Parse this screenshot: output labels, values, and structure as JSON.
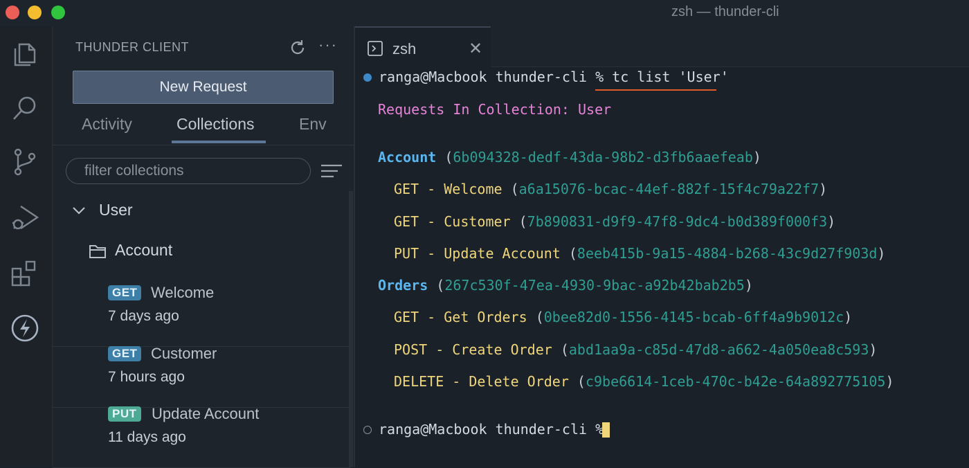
{
  "window": {
    "title": "zsh — thunder-cli",
    "traffic_lights": [
      "close",
      "minimize",
      "zoom"
    ]
  },
  "activity_bar": {
    "icons": [
      "files-icon",
      "search-icon",
      "source-control-icon",
      "run-debug-icon",
      "extensions-icon",
      "thunder-client-icon"
    ]
  },
  "sidebar": {
    "title": "THUNDER CLIENT",
    "new_request_label": "New Request",
    "tabs": [
      {
        "label": "Activity"
      },
      {
        "label": "Collections"
      },
      {
        "label": "Env"
      }
    ],
    "active_tab": "Collections",
    "filter_placeholder": "filter collections",
    "collection": {
      "name": "User",
      "folder": "Account",
      "requests": [
        {
          "method": "GET",
          "name": "Welcome",
          "time": "7 days ago"
        },
        {
          "method": "GET",
          "name": "Customer",
          "time": "7 hours ago"
        },
        {
          "method": "PUT",
          "name": "Update Account",
          "time": "11 days ago"
        }
      ]
    }
  },
  "terminal": {
    "tab_label": "zsh",
    "prompt": "ranga@Macbook thunder-cli %",
    "command": "tc list 'User'",
    "header": "Requests In Collection: User",
    "folders": [
      {
        "name": "Account",
        "id": "6b094328-dedf-43da-98b2-d3fb6aaefeab",
        "requests": [
          {
            "method": "GET",
            "name": "Welcome",
            "id": "a6a15076-bcac-44ef-882f-15f4c79a22f7"
          },
          {
            "method": "GET",
            "name": "Customer",
            "id": "7b890831-d9f9-47f8-9dc4-b0d389f000f3"
          },
          {
            "method": "PUT",
            "name": "Update Account",
            "id": "8eeb415b-9a15-4884-b268-43c9d27f903d"
          }
        ]
      },
      {
        "name": "Orders",
        "id": "267c530f-47ea-4930-9bac-a92b42bab2b5",
        "requests": [
          {
            "method": "GET",
            "name": "Get Orders",
            "id": "0bee82d0-1556-4145-bcab-6ff4a9b9012c"
          },
          {
            "method": "POST",
            "name": "Create Order",
            "id": "abd1aa9a-c85d-47d8-a662-4a050ea8c593"
          },
          {
            "method": "DELETE",
            "name": "Delete Order",
            "id": "c9be6614-1ceb-470c-b42e-64a892775105"
          }
        ]
      }
    ]
  },
  "colors": {
    "accent_pink": "#e783d9",
    "folder_blue": "#5cb6ee",
    "uuid_teal": "#2f9e93",
    "method_yellow": "#f0d67a",
    "get_badge": "#3d7fa6",
    "put_badge": "#4caa95",
    "command_underline": "#e05a2b"
  }
}
